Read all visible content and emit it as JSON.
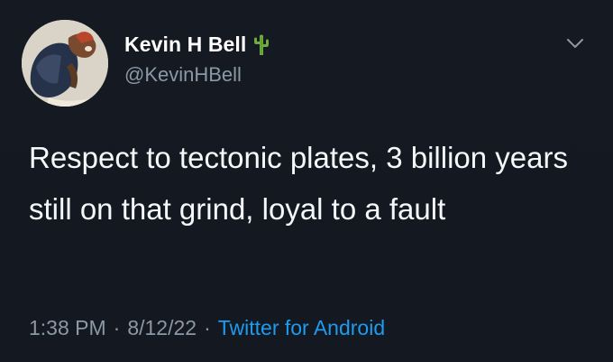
{
  "author": {
    "display_name": "Kevin H Bell",
    "handle": "@KevinHBell",
    "name_emoji": "cactus-icon",
    "avatar": "avatar-image"
  },
  "tweet": {
    "text": "Respect to tectonic plates, 3 billion years still on that grind, loyal to a fault"
  },
  "meta": {
    "time": "1:38 PM",
    "date": "8/12/22",
    "source": "Twitter for Android",
    "separator": "·"
  },
  "menu": {
    "icon": "chevron-down-icon"
  },
  "colors": {
    "background": "#151a22",
    "text": "#f5f7f9",
    "secondary": "#8b98a5",
    "link": "#1d9bf0"
  }
}
